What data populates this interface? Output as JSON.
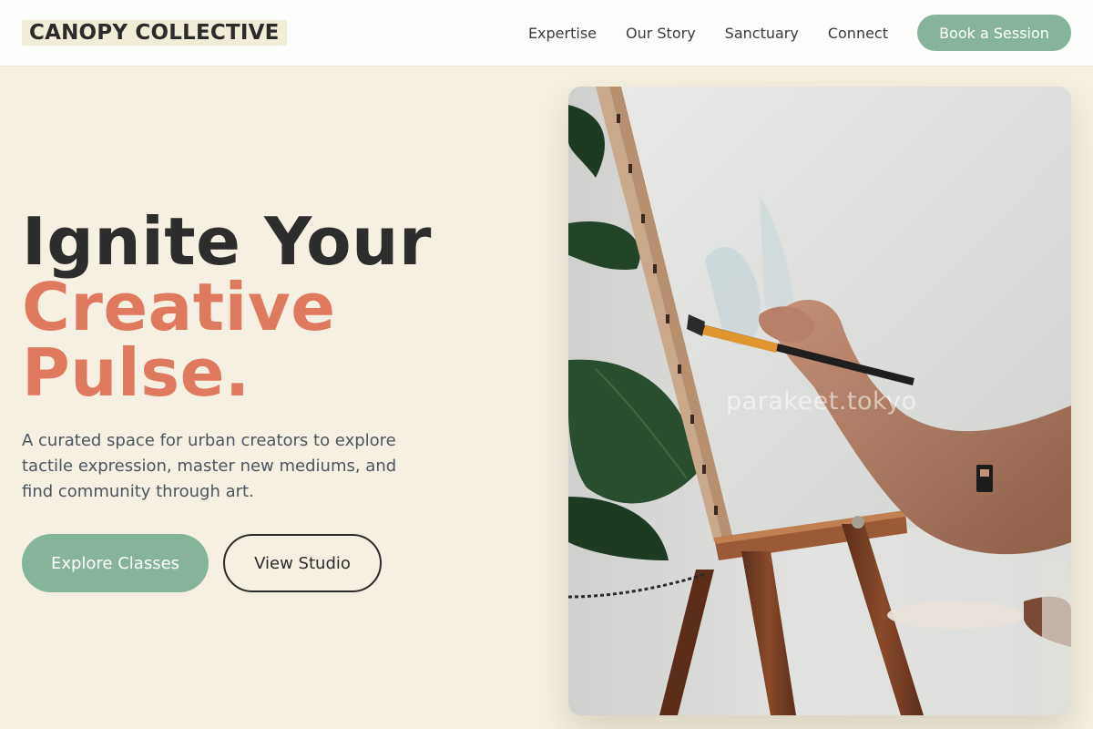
{
  "header": {
    "brand": "CANOPY COLLECTIVE",
    "nav": [
      "Expertise",
      "Our Story",
      "Sanctuary",
      "Connect"
    ],
    "cta": "Book a Session"
  },
  "hero": {
    "title_line1": "Ignite Your",
    "title_line2": "Creative",
    "title_line3": "Pulse.",
    "subtitle": "A curated space for urban creators to explore tactile expression, master new mediums, and find community through art.",
    "primary_button": "Explore Classes",
    "secondary_button": "View Studio"
  },
  "image": {
    "watermark": "parakeet.tokyo"
  },
  "colors": {
    "background": "#f5f0e1",
    "accent_green": "#85b49b",
    "accent_coral": "#e07a5f",
    "text_dark": "#2d2d2d"
  }
}
